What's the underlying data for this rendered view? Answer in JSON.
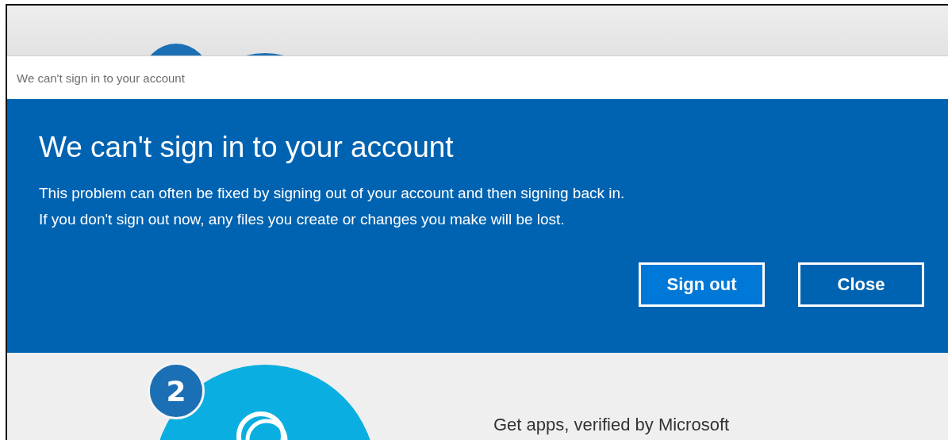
{
  "title_bar": {
    "title": "We can't sign in to your account"
  },
  "dialog": {
    "heading": "We can't sign in to your account",
    "lines": [
      "This problem can often be fixed by signing out of your account and then signing back in.",
      "If you don't sign out now, any files you create or changes you make will be lost."
    ],
    "buttons": [
      {
        "label": "Sign out",
        "default": true
      },
      {
        "label": "Close",
        "default": false
      }
    ]
  },
  "background": {
    "step_badge": "2",
    "caption": "Get apps, verified by Microsoft"
  }
}
